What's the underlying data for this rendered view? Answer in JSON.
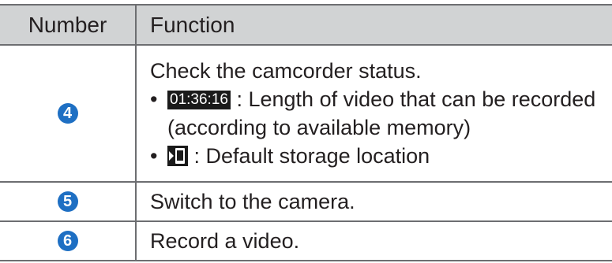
{
  "header": {
    "number_label": "Number",
    "function_label": "Function"
  },
  "rows": [
    {
      "number": "4",
      "intro": "Check the camcorder status.",
      "bullets": [
        {
          "bullet": "•",
          "chip": "01:36:16",
          "text": ": Length of video that can be recorded (according to available memory)"
        },
        {
          "bullet": "•",
          "icon": "storage-location-icon",
          "text": ": Default storage location"
        }
      ]
    },
    {
      "number": "5",
      "text": "Switch to the camera."
    },
    {
      "number": "6",
      "text": "Record a video."
    }
  ],
  "colors": {
    "header_bg": "#d1d3d4",
    "border": "#6d6e71",
    "badge": "#1e6fc3",
    "chip_bg": "#1a1a1a"
  }
}
